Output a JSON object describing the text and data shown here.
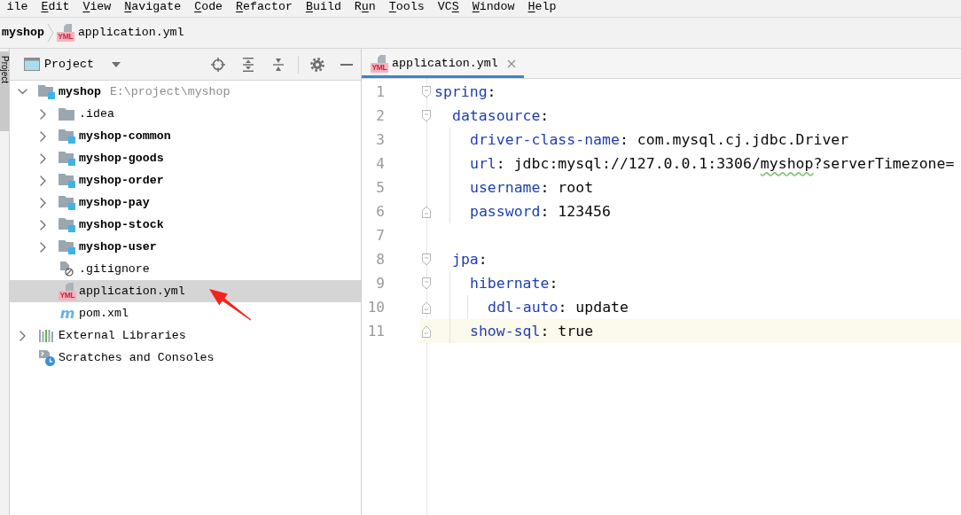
{
  "menu_bar": {
    "items": [
      {
        "pre": "ile"
      },
      {
        "key": "E",
        "post": "dit"
      },
      {
        "key": "V",
        "post": "iew"
      },
      {
        "key": "N",
        "post": "avigate"
      },
      {
        "key": "C",
        "post": "ode"
      },
      {
        "key": "R",
        "post": "efactor"
      },
      {
        "key": "B",
        "post": "uild"
      },
      {
        "pre": "R",
        "key": "u",
        "post": "n"
      },
      {
        "key": "T",
        "post": "ools"
      },
      {
        "pre": "VC",
        "key": "S"
      },
      {
        "key": "W",
        "post": "indow"
      },
      {
        "key": "H",
        "post": "elp"
      }
    ]
  },
  "breadcrumbs": [
    {
      "kind": "module",
      "label": "myshop"
    },
    {
      "kind": "yml-file",
      "label": "application.yml",
      "icon_label": "YML"
    }
  ],
  "tool_stripe": {
    "tabs": [
      {
        "label": "Project",
        "selected": true
      }
    ]
  },
  "project_panel": {
    "header": {
      "title": "Project"
    },
    "tree": [
      {
        "kind": "module",
        "label": "myshop",
        "path": "E:\\project\\myshop",
        "expanded": true,
        "selected": false,
        "children": [
          {
            "kind": "folder",
            "label": ".idea",
            "expanded": false,
            "selected": false
          },
          {
            "kind": "module",
            "label": "myshop-common",
            "expanded": false,
            "selected": false
          },
          {
            "kind": "module",
            "label": "myshop-goods",
            "expanded": false,
            "selected": false
          },
          {
            "kind": "module",
            "label": "myshop-order",
            "expanded": false,
            "selected": false
          },
          {
            "kind": "module",
            "label": "myshop-pay",
            "expanded": false,
            "selected": false
          },
          {
            "kind": "module",
            "label": "myshop-stock",
            "expanded": false,
            "selected": false
          },
          {
            "kind": "module",
            "label": "myshop-user",
            "expanded": false,
            "selected": false
          },
          {
            "kind": "ignore-file",
            "label": ".gitignore",
            "selected": false
          },
          {
            "kind": "yml-file",
            "label": "application.yml",
            "icon_label": "YML",
            "selected": true
          },
          {
            "kind": "maven-file",
            "label": "pom.xml",
            "icon_label": "m",
            "selected": false
          }
        ]
      },
      {
        "kind": "libraries",
        "label": "External Libraries",
        "expanded": false,
        "selected": false
      },
      {
        "kind": "scratches",
        "label": "Scratches and Consoles",
        "selected": false
      }
    ],
    "annotations": [
      {
        "kind": "arrow"
      }
    ]
  },
  "editor": {
    "tabs": [
      {
        "kind": "yml-file",
        "label": "application.yml",
        "icon_label": "YML",
        "selected": true
      }
    ],
    "line_numbers": [
      "1",
      "2",
      "3",
      "4",
      "5",
      "6",
      "7",
      "8",
      "9",
      "10",
      "11"
    ],
    "code": [
      {
        "kind": "mapping",
        "key": "spring",
        "sep": ":",
        "current": false,
        "children": [
          {
            "kind": "mapping",
            "key": "datasource",
            "sep": ":",
            "current": false,
            "children": [
              {
                "kind": "pair",
                "key": "driver-class-name",
                "sep": ": ",
                "current": false,
                "value": [
                  {
                    "text": "com.mysql.cj.jdbc.Driver",
                    "typo": false
                  }
                ]
              },
              {
                "kind": "pair",
                "key": "url",
                "sep": ": ",
                "current": false,
                "value": [
                  {
                    "text": "jdbc:mysql://127.0.0.1:3306/",
                    "typo": false
                  },
                  {
                    "text": "myshop",
                    "typo": true
                  },
                  {
                    "text": "?serverTimezone=",
                    "typo": false
                  }
                ]
              },
              {
                "kind": "pair",
                "key": "username",
                "sep": ": ",
                "current": false,
                "value": [
                  {
                    "text": "root",
                    "typo": false
                  }
                ]
              },
              {
                "kind": "pair",
                "key": "password",
                "sep": ": ",
                "current": false,
                "value": [
                  {
                    "text": "123456",
                    "typo": false
                  }
                ]
              }
            ]
          },
          {
            "kind": "blank",
            "current": false
          },
          {
            "kind": "mapping",
            "key": "jpa",
            "sep": ":",
            "current": false,
            "children": [
              {
                "kind": "mapping",
                "key": "hibernate",
                "sep": ":",
                "current": false,
                "children": [
                  {
                    "kind": "pair",
                    "key": "ddl-auto",
                    "sep": ": ",
                    "current": false,
                    "value": [
                      {
                        "text": "update",
                        "typo": false
                      }
                    ]
                  }
                ]
              },
              {
                "kind": "pair",
                "key": "show-sql",
                "sep": ": ",
                "current": true,
                "value": [
                  {
                    "text": "true",
                    "typo": false
                  }
                ]
              }
            ]
          }
        ]
      }
    ]
  }
}
